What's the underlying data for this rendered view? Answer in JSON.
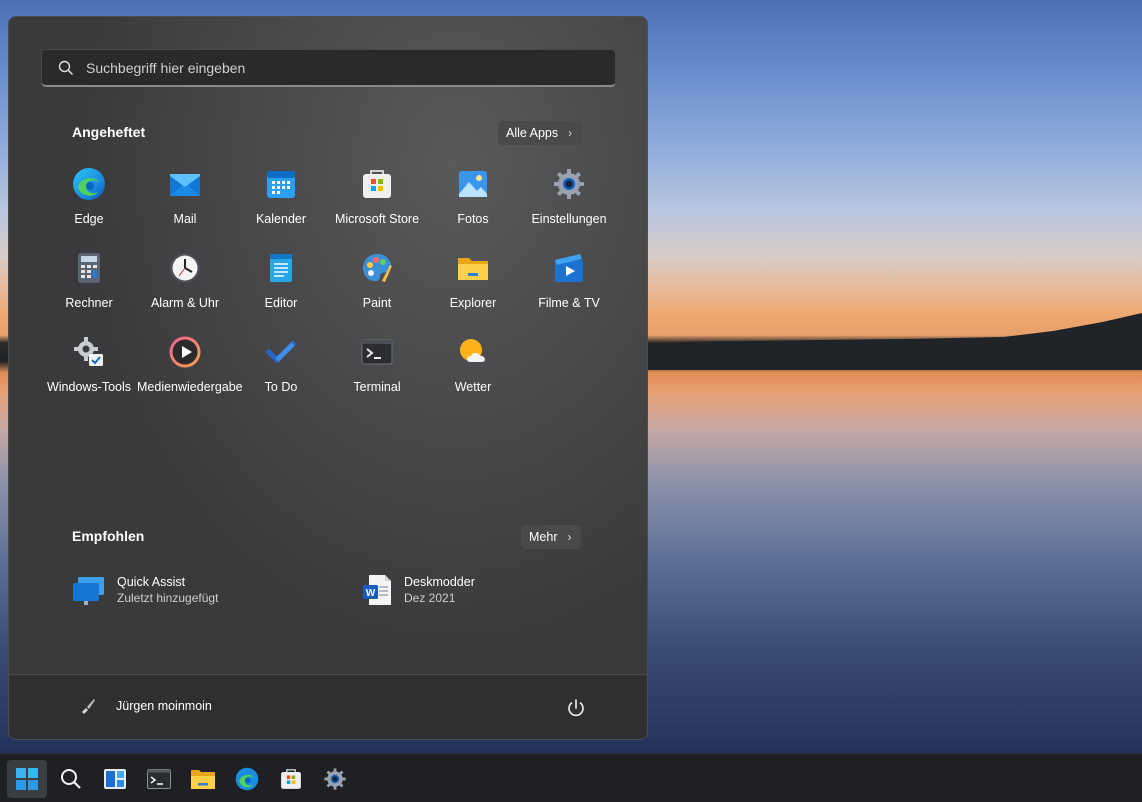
{
  "search": {
    "placeholder": "Suchbegriff hier eingeben"
  },
  "pinned": {
    "title": "Angeheftet",
    "all_apps_label": "Alle Apps",
    "apps": [
      {
        "label": "Edge",
        "icon": "edge-icon"
      },
      {
        "label": "Mail",
        "icon": "mail-icon"
      },
      {
        "label": "Kalender",
        "icon": "calendar-icon"
      },
      {
        "label": "Microsoft Store",
        "icon": "store-icon"
      },
      {
        "label": "Fotos",
        "icon": "photos-icon"
      },
      {
        "label": "Einstellungen",
        "icon": "settings-icon"
      },
      {
        "label": "Rechner",
        "icon": "calculator-icon"
      },
      {
        "label": "Alarm & Uhr",
        "icon": "clock-icon"
      },
      {
        "label": "Editor",
        "icon": "notepad-icon"
      },
      {
        "label": "Paint",
        "icon": "paint-icon"
      },
      {
        "label": "Explorer",
        "icon": "folder-icon"
      },
      {
        "label": "Filme & TV",
        "icon": "movies-icon"
      },
      {
        "label": "Windows-Tools",
        "icon": "tools-icon"
      },
      {
        "label": "Medienwiedergabe",
        "icon": "media-player-icon"
      },
      {
        "label": "To Do",
        "icon": "todo-icon"
      },
      {
        "label": "Terminal",
        "icon": "terminal-icon"
      },
      {
        "label": "Wetter",
        "icon": "weather-icon"
      }
    ]
  },
  "recommended": {
    "title": "Empfohlen",
    "more_label": "Mehr",
    "items": [
      {
        "label": "Quick Assist",
        "sub": "Zuletzt hinzugefügt",
        "icon": "quick-assist-icon"
      },
      {
        "label": "Deskmodder",
        "sub": "Dez 2021",
        "icon": "word-document-icon"
      }
    ]
  },
  "footer": {
    "user_name": "Jürgen moinmoin"
  },
  "taskbar": {
    "items": [
      "start-icon",
      "search-icon",
      "widgets-icon",
      "terminal-icon",
      "explorer-icon",
      "edge-icon",
      "store-icon",
      "settings-icon"
    ]
  },
  "colors": {
    "accent": "#0078d4",
    "menu_bg": "#3b3b3d",
    "taskbar_bg": "#1e2024"
  }
}
